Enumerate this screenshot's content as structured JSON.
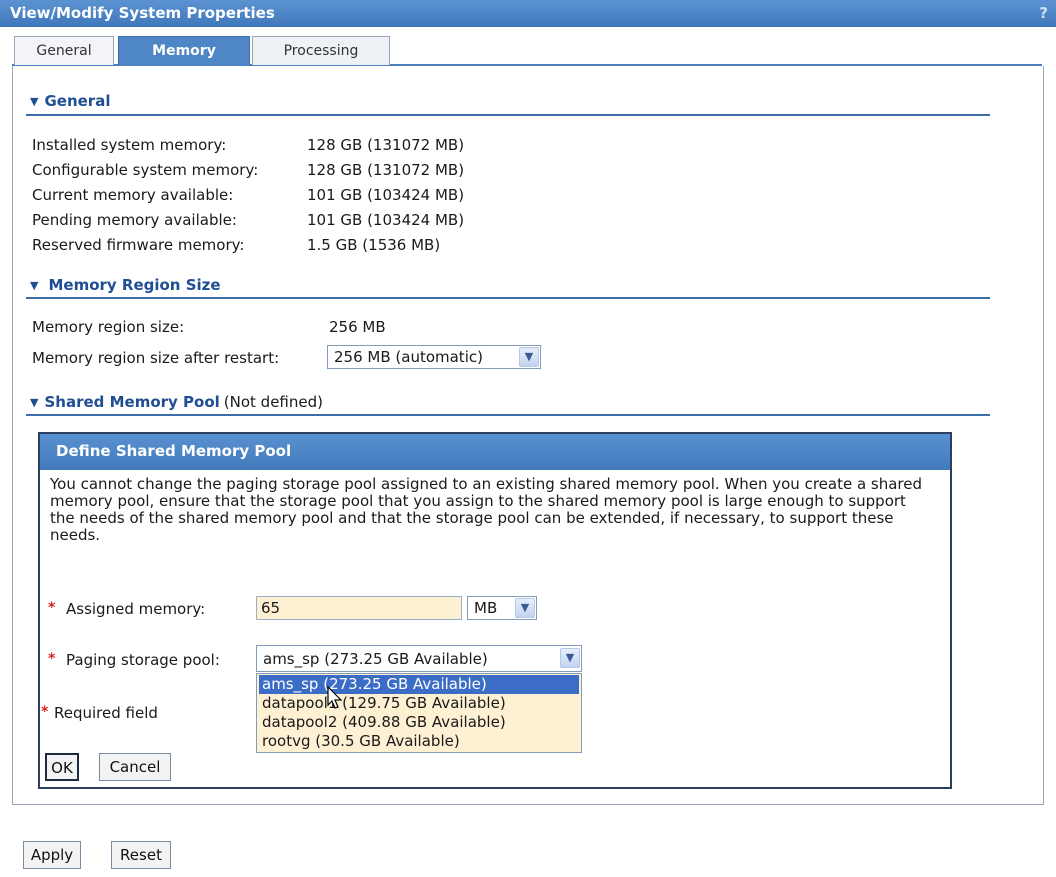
{
  "window": {
    "title": "View/Modify System Properties",
    "help": "?"
  },
  "tabs": [
    {
      "label": "General"
    },
    {
      "label": "Memory"
    },
    {
      "label": "Processing"
    }
  ],
  "general_section": {
    "header": "General",
    "rows": [
      {
        "label": "Installed system memory:",
        "value": "128 GB (131072 MB)"
      },
      {
        "label": "Configurable system memory:",
        "value": "128 GB (131072 MB)"
      },
      {
        "label": "Current memory available:",
        "value": "101 GB (103424 MB)"
      },
      {
        "label": "Pending memory available:",
        "value": "101 GB (103424 MB)"
      },
      {
        "label": "Reserved firmware memory:",
        "value": "1.5 GB (1536 MB)"
      }
    ]
  },
  "region_section": {
    "header": "Memory Region Size",
    "size_label": "Memory region size:",
    "size_value": "256 MB",
    "after_restart_label": "Memory region size after restart:",
    "after_restart_value": "256 MB (automatic)"
  },
  "shared_section": {
    "header": "Shared Memory Pool",
    "status": "(Not defined)"
  },
  "dialog": {
    "title": "Define Shared Memory Pool",
    "description": "You cannot change the paging storage pool assigned to an existing shared memory pool. When you create a shared memory pool, ensure that the storage pool that you assign to the shared memory pool is large enough to support the needs of the shared memory pool and that the storage pool can be extended, if necessary, to support these needs.",
    "required_marker": "*",
    "assigned_memory_label": "Assigned memory:",
    "assigned_memory_value": "65",
    "unit_value": "MB",
    "paging_pool_label": "Paging storage pool:",
    "paging_pool_value": "ams_sp (273.25 GB Available)",
    "paging_pool_options": [
      "ams_sp (273.25 GB Available)",
      "datapool1 (129.75 GB Available)",
      "datapool2 (409.88 GB Available)",
      "rootvg (30.5 GB Available)"
    ],
    "required_field_text": "Required field",
    "ok_label": "OK",
    "cancel_label": "Cancel"
  },
  "footer": {
    "apply_label": "Apply",
    "reset_label": "Reset"
  },
  "colors": {
    "accent": "#4d86c6",
    "section_text": "#1f4e93",
    "input_bg": "#fdf0d3",
    "selection": "#3b6dc6"
  }
}
